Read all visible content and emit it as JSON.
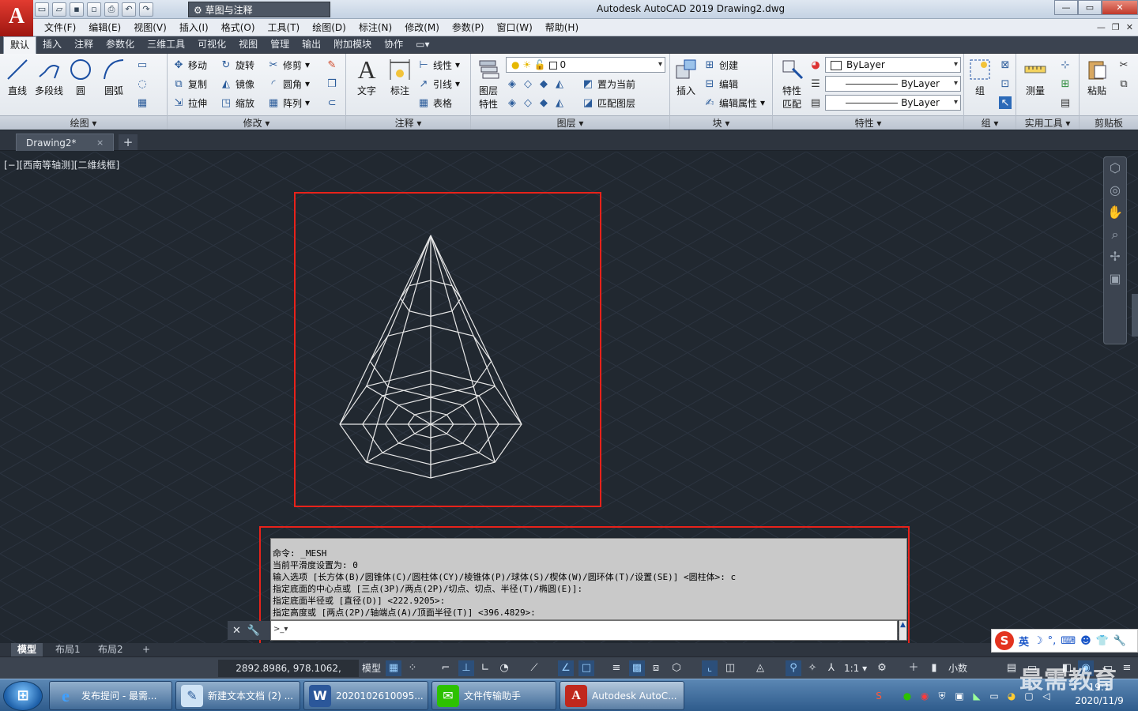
{
  "app": {
    "logo_letter": "A",
    "workspace": "草图与注释",
    "title": "Autodesk AutoCAD 2019    Drawing2.dwg"
  },
  "menus": [
    "文件(F)",
    "编辑(E)",
    "视图(V)",
    "插入(I)",
    "格式(O)",
    "工具(T)",
    "绘图(D)",
    "标注(N)",
    "修改(M)",
    "参数(P)",
    "窗口(W)",
    "帮助(H)"
  ],
  "ribbon_tabs": [
    "默认",
    "插入",
    "注释",
    "参数化",
    "三维工具",
    "可视化",
    "视图",
    "管理",
    "输出",
    "附加模块",
    "协作"
  ],
  "ribbon": {
    "draw": {
      "title": "绘图 ▾",
      "line": "直线",
      "polyline": "多段线",
      "circle": "圆",
      "arc": "圆弧"
    },
    "modify": {
      "title": "修改 ▾",
      "move": "移动",
      "rotate": "旋转",
      "trim": "修剪",
      "copy": "复制",
      "mirror": "镜像",
      "fillet": "圆角",
      "stretch": "拉伸",
      "scale": "缩放",
      "array": "阵列"
    },
    "annotation": {
      "title": "注释 ▾",
      "text": "文字",
      "dimension": "标注",
      "linear": "线性",
      "leader": "引线",
      "table": "表格"
    },
    "layers": {
      "title": "图层 ▾",
      "layer_props_1": "图层",
      "layer_props_2": "特性",
      "current_layer": "0",
      "make_current": "置为当前",
      "match_layer": "匹配图层"
    },
    "block": {
      "title": "块 ▾",
      "insert": "插入",
      "create": "创建",
      "edit": "编辑",
      "edit_attr": "编辑属性"
    },
    "properties": {
      "title": "特性 ▾",
      "match_1": "特性",
      "match_2": "匹配",
      "color": "ByLayer",
      "linetype": "ByLayer",
      "lineweight": "ByLayer"
    },
    "groups": {
      "title": "组 ▾",
      "group": "组"
    },
    "utilities": {
      "title": "实用工具 ▾",
      "measure": "测量"
    },
    "clipboard": {
      "title": "剪贴板",
      "paste": "粘贴"
    }
  },
  "doc_tab": {
    "name": "Drawing2*",
    "close": "×",
    "add": "+"
  },
  "viewport": {
    "label": "[−][西南等轴测][二维线框]"
  },
  "command": {
    "history": [
      "命令: _MESH",
      "当前平滑度设置为: 0",
      "输入选项 [长方体(B)/圆锥体(C)/圆柱体(CY)/棱锥体(P)/球体(S)/楔体(W)/圆环体(T)/设置(SE)] <圆柱体>: c",
      "指定底面的中心点或 [三点(3P)/两点(2P)/切点、切点、半径(T)/椭圆(E)]:",
      "指定底面半径或 [直径(D)] <222.9205>:",
      "指定高度或 [两点(2P)/轴端点(A)/顶面半径(T)] <396.4829>:"
    ],
    "input_value": "",
    "prompt_icon": ">_▾"
  },
  "layout_tabs": [
    "模型",
    "布局1",
    "布局2",
    "+"
  ],
  "status": {
    "coords": "2892.8986, 978.1062, 0.0000",
    "model": "模型",
    "scale": "1:1 ▾",
    "units": "小数"
  },
  "ime": {
    "logo": "S",
    "lang": "英"
  },
  "taskbar": [
    {
      "label": "发布提问 - 最需...",
      "icon": "e"
    },
    {
      "label": "新建文本文档 (2) ...",
      "icon": "✎"
    },
    {
      "label": "2020102610095...",
      "icon": "W"
    },
    {
      "label": "文件传输助手",
      "icon": "✉"
    },
    {
      "label": "Autodesk AutoC...",
      "icon": "A"
    }
  ],
  "clock": {
    "time": "19:1",
    "date": "2020/11/9"
  },
  "watermark": "最需教育",
  "colors": {
    "accent_red": "#e8221a",
    "viewport_bg": "#212830",
    "ribbon_bg": "#e1e6ec"
  }
}
